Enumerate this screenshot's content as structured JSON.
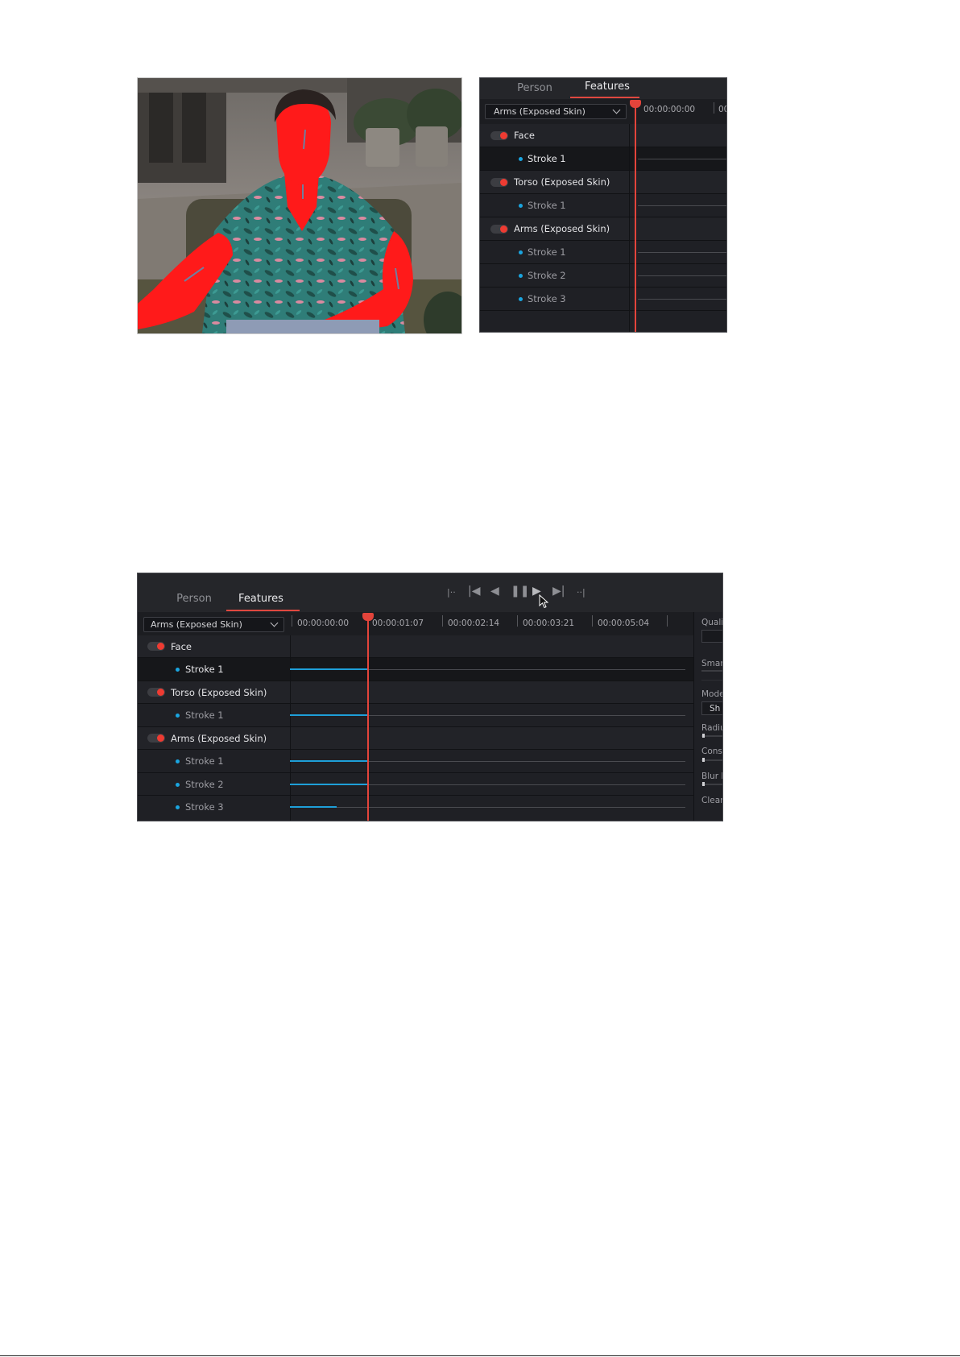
{
  "top_panel": {
    "tabs": [
      "Person",
      "Features"
    ],
    "active_tab": "Features",
    "dropdown": "Arms (Exposed Skin)",
    "timecodes": [
      "00:00:00:00",
      "00"
    ],
    "rows": [
      {
        "type": "parent",
        "label": "Face"
      },
      {
        "type": "child",
        "label": "Stroke 1",
        "selected": true
      },
      {
        "type": "parent",
        "label": "Torso (Exposed Skin)"
      },
      {
        "type": "child",
        "label": "Stroke 1"
      },
      {
        "type": "parent",
        "label": "Arms (Exposed Skin)"
      },
      {
        "type": "child",
        "label": "Stroke 1"
      },
      {
        "type": "child",
        "label": "Stroke 2"
      },
      {
        "type": "child",
        "label": "Stroke 3"
      }
    ]
  },
  "bottom_panel": {
    "tabs": [
      "Person",
      "Features"
    ],
    "active_tab": "Features",
    "dropdown": "Arms (Exposed Skin)",
    "timecodes": [
      "00:00:00:00",
      "00:00:01:07",
      "00:00:02:14",
      "00:00:03:21",
      "00:00:05:04"
    ],
    "rows": [
      {
        "type": "parent",
        "label": "Face"
      },
      {
        "type": "child",
        "label": "Stroke 1",
        "selected": true,
        "tracked": 0.1
      },
      {
        "type": "parent",
        "label": "Torso (Exposed Skin)"
      },
      {
        "type": "child",
        "label": "Stroke 1",
        "tracked": 0.1
      },
      {
        "type": "parent",
        "label": "Arms (Exposed Skin)"
      },
      {
        "type": "child",
        "label": "Stroke 1",
        "tracked": 0.1
      },
      {
        "type": "child",
        "label": "Stroke 2",
        "tracked": 0.1
      },
      {
        "type": "child",
        "label": "Stroke 3",
        "tracked": 0.06
      }
    ],
    "transport": {
      "go_start": "|··",
      "prev_frame": "|◀",
      "reverse": "◀",
      "pause": "❚❚",
      "play": "▶",
      "next_frame": "▶|",
      "go_end": "··|"
    },
    "side_labels": [
      "Quali",
      "Smar",
      "Mode",
      "Sh",
      "Radiu",
      "Cons",
      "Blur l",
      "Clean"
    ]
  },
  "colors": {
    "accent_red": "#e3443b",
    "track_blue": "#1e9fd8",
    "panel_bg": "#1c1d21"
  }
}
